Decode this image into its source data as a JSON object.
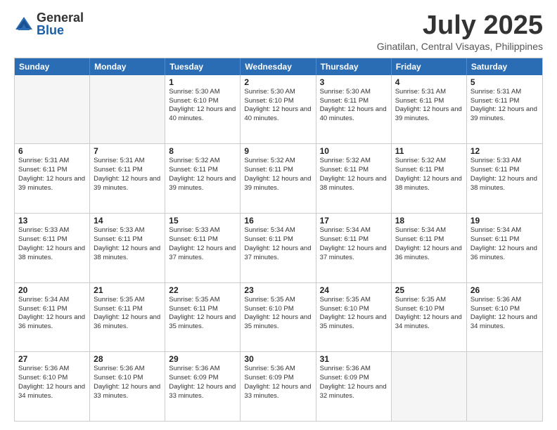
{
  "logo": {
    "general": "General",
    "blue": "Blue"
  },
  "title": "July 2025",
  "subtitle": "Ginatilan, Central Visayas, Philippines",
  "header_days": [
    "Sunday",
    "Monday",
    "Tuesday",
    "Wednesday",
    "Thursday",
    "Friday",
    "Saturday"
  ],
  "rows": [
    [
      {
        "day": "",
        "text": ""
      },
      {
        "day": "",
        "text": ""
      },
      {
        "day": "1",
        "text": "Sunrise: 5:30 AM\nSunset: 6:10 PM\nDaylight: 12 hours and 40 minutes."
      },
      {
        "day": "2",
        "text": "Sunrise: 5:30 AM\nSunset: 6:10 PM\nDaylight: 12 hours and 40 minutes."
      },
      {
        "day": "3",
        "text": "Sunrise: 5:30 AM\nSunset: 6:11 PM\nDaylight: 12 hours and 40 minutes."
      },
      {
        "day": "4",
        "text": "Sunrise: 5:31 AM\nSunset: 6:11 PM\nDaylight: 12 hours and 39 minutes."
      },
      {
        "day": "5",
        "text": "Sunrise: 5:31 AM\nSunset: 6:11 PM\nDaylight: 12 hours and 39 minutes."
      }
    ],
    [
      {
        "day": "6",
        "text": "Sunrise: 5:31 AM\nSunset: 6:11 PM\nDaylight: 12 hours and 39 minutes."
      },
      {
        "day": "7",
        "text": "Sunrise: 5:31 AM\nSunset: 6:11 PM\nDaylight: 12 hours and 39 minutes."
      },
      {
        "day": "8",
        "text": "Sunrise: 5:32 AM\nSunset: 6:11 PM\nDaylight: 12 hours and 39 minutes."
      },
      {
        "day": "9",
        "text": "Sunrise: 5:32 AM\nSunset: 6:11 PM\nDaylight: 12 hours and 39 minutes."
      },
      {
        "day": "10",
        "text": "Sunrise: 5:32 AM\nSunset: 6:11 PM\nDaylight: 12 hours and 38 minutes."
      },
      {
        "day": "11",
        "text": "Sunrise: 5:32 AM\nSunset: 6:11 PM\nDaylight: 12 hours and 38 minutes."
      },
      {
        "day": "12",
        "text": "Sunrise: 5:33 AM\nSunset: 6:11 PM\nDaylight: 12 hours and 38 minutes."
      }
    ],
    [
      {
        "day": "13",
        "text": "Sunrise: 5:33 AM\nSunset: 6:11 PM\nDaylight: 12 hours and 38 minutes."
      },
      {
        "day": "14",
        "text": "Sunrise: 5:33 AM\nSunset: 6:11 PM\nDaylight: 12 hours and 38 minutes."
      },
      {
        "day": "15",
        "text": "Sunrise: 5:33 AM\nSunset: 6:11 PM\nDaylight: 12 hours and 37 minutes."
      },
      {
        "day": "16",
        "text": "Sunrise: 5:34 AM\nSunset: 6:11 PM\nDaylight: 12 hours and 37 minutes."
      },
      {
        "day": "17",
        "text": "Sunrise: 5:34 AM\nSunset: 6:11 PM\nDaylight: 12 hours and 37 minutes."
      },
      {
        "day": "18",
        "text": "Sunrise: 5:34 AM\nSunset: 6:11 PM\nDaylight: 12 hours and 36 minutes."
      },
      {
        "day": "19",
        "text": "Sunrise: 5:34 AM\nSunset: 6:11 PM\nDaylight: 12 hours and 36 minutes."
      }
    ],
    [
      {
        "day": "20",
        "text": "Sunrise: 5:34 AM\nSunset: 6:11 PM\nDaylight: 12 hours and 36 minutes."
      },
      {
        "day": "21",
        "text": "Sunrise: 5:35 AM\nSunset: 6:11 PM\nDaylight: 12 hours and 36 minutes."
      },
      {
        "day": "22",
        "text": "Sunrise: 5:35 AM\nSunset: 6:11 PM\nDaylight: 12 hours and 35 minutes."
      },
      {
        "day": "23",
        "text": "Sunrise: 5:35 AM\nSunset: 6:10 PM\nDaylight: 12 hours and 35 minutes."
      },
      {
        "day": "24",
        "text": "Sunrise: 5:35 AM\nSunset: 6:10 PM\nDaylight: 12 hours and 35 minutes."
      },
      {
        "day": "25",
        "text": "Sunrise: 5:35 AM\nSunset: 6:10 PM\nDaylight: 12 hours and 34 minutes."
      },
      {
        "day": "26",
        "text": "Sunrise: 5:36 AM\nSunset: 6:10 PM\nDaylight: 12 hours and 34 minutes."
      }
    ],
    [
      {
        "day": "27",
        "text": "Sunrise: 5:36 AM\nSunset: 6:10 PM\nDaylight: 12 hours and 34 minutes."
      },
      {
        "day": "28",
        "text": "Sunrise: 5:36 AM\nSunset: 6:10 PM\nDaylight: 12 hours and 33 minutes."
      },
      {
        "day": "29",
        "text": "Sunrise: 5:36 AM\nSunset: 6:09 PM\nDaylight: 12 hours and 33 minutes."
      },
      {
        "day": "30",
        "text": "Sunrise: 5:36 AM\nSunset: 6:09 PM\nDaylight: 12 hours and 33 minutes."
      },
      {
        "day": "31",
        "text": "Sunrise: 5:36 AM\nSunset: 6:09 PM\nDaylight: 12 hours and 32 minutes."
      },
      {
        "day": "",
        "text": ""
      },
      {
        "day": "",
        "text": ""
      }
    ]
  ]
}
